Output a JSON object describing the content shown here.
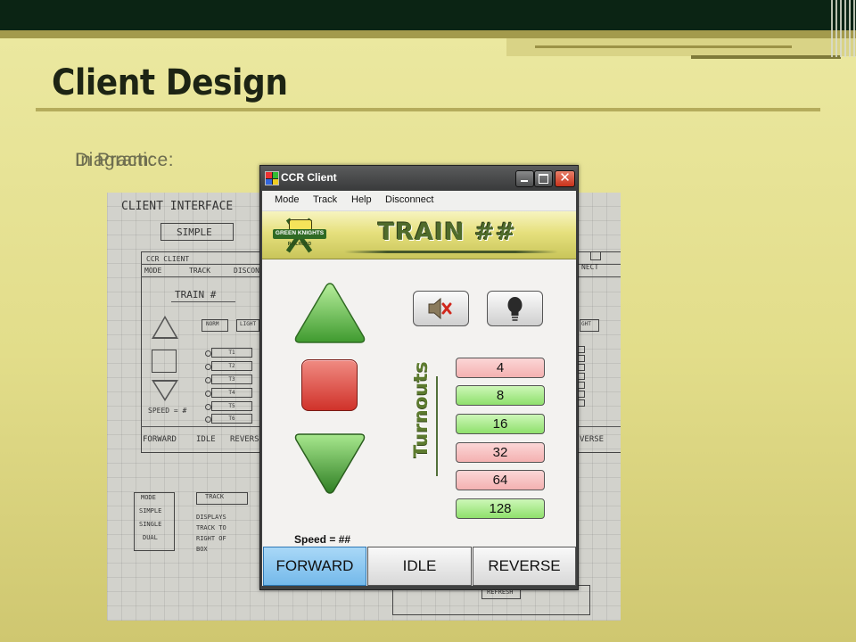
{
  "slide": {
    "title": "Client Design",
    "label_a": "Diagram:",
    "label_b": "In Practice:"
  },
  "sketch": {
    "header": "CLIENT INTERFACE",
    "mode": "SIMPLE",
    "window_title": "CCR CLIENT",
    "menu": [
      "MODE",
      "TRACK",
      "DISCONN"
    ],
    "connect_frag": "NECT",
    "train": "TRAIN #",
    "norm": "NORM",
    "light": "LIGHT",
    "turnouts": [
      "T1",
      "T2",
      "T3",
      "T4",
      "T5",
      "T6"
    ],
    "speed": "SPEED = #",
    "bottom": [
      "FORWARD",
      "IDLE",
      "REVERSE"
    ],
    "reverse_frag": "VERSE",
    "light_frag": "GHT",
    "mode_box": [
      "MODE",
      "SIMPLE",
      "SINGLE",
      "DUAL"
    ],
    "track_box": "TRACK",
    "track_note": [
      "DISPLAYS",
      "TRACK TO",
      "RIGHT OF",
      "BOX"
    ],
    "refresh": "REFRESH"
  },
  "window": {
    "title": "CCR Client",
    "close_glyph": "✕",
    "menu": [
      "Mode",
      "Track",
      "Help",
      "Disconnect"
    ],
    "logo_line1": "GREEN KNIGHTS",
    "logo_line2": "RAILROAD",
    "banner_title": "TRAIN ##",
    "speed_label": "Speed = ##",
    "turnouts_label": "Turnouts",
    "turnouts": [
      {
        "value": "4",
        "state": "red"
      },
      {
        "value": "8",
        "state": "green"
      },
      {
        "value": "16",
        "state": "green"
      },
      {
        "value": "32",
        "state": "red"
      },
      {
        "value": "64",
        "state": "red"
      },
      {
        "value": "128",
        "state": "green"
      }
    ],
    "direction": [
      "FORWARD",
      "IDLE",
      "REVERSE"
    ]
  },
  "colors": {
    "background": "#e6e08c",
    "topbar": "#0b2414",
    "turnout_red": "#f4b1b1",
    "turnout_green": "#8fe06c",
    "forward_active": "#74b9ea"
  },
  "icons": [
    "speaker-mute-icon",
    "light-bulb-icon",
    "up-arrow-icon",
    "stop-icon",
    "down-arrow-icon"
  ]
}
